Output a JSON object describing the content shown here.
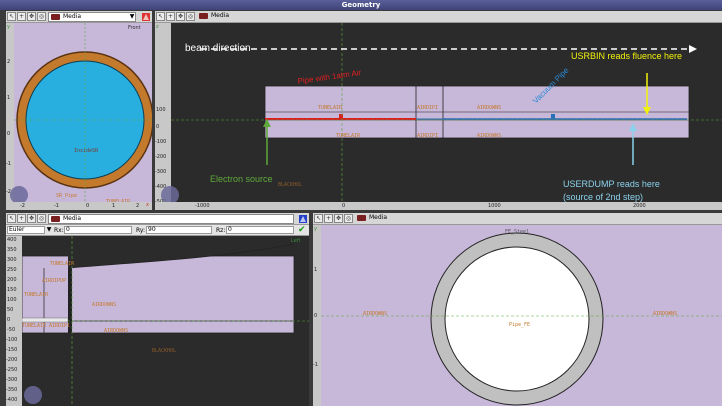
{
  "window": {
    "title": "Geometry"
  },
  "views": {
    "front": {
      "layer": "Media",
      "label": "Front",
      "regions": [
        "InsideSR",
        "SR_Pipe",
        "TUNELAIR"
      ],
      "ticks_y": [
        "2",
        "1",
        "0",
        "-1",
        "-2"
      ],
      "ticks_x": [
        "-2",
        "-1",
        "0",
        "1",
        "2"
      ],
      "axis": "y",
      "x_axis": "x"
    },
    "top": {
      "layer": "Media",
      "regions_top": [
        "TUNELAIR",
        "AIRDIPI",
        "AIRDOWNS"
      ],
      "regions_bottom": [
        "TUNELAIR",
        "AIRDIPI",
        "AIRDOWNS"
      ],
      "blackhole": "BLACKHOL",
      "ticks_y": [
        "100",
        "0",
        "-100",
        "-200",
        "-300",
        "-400",
        "-500"
      ],
      "ticks_x": [
        "-1000",
        "0",
        "1000",
        "2000"
      ],
      "axis": "z",
      "annotations": {
        "beam": "beam direction",
        "pipe": "Pipe with 1atm Air",
        "vacuum": "Vacuum Pipe",
        "usrbin": "USRBIN reads fluence here",
        "source": "Electron source",
        "userdump_1": "USERDUMP reads here",
        "userdump_2": "(source of 2nd  step)"
      }
    },
    "left": {
      "layer": "Media",
      "label": "Left",
      "rot_mode": "Euler",
      "rx_label": "Rx:",
      "rx": "0",
      "ry_label": "Ry:",
      "ry": "90",
      "rz_label": "Rz:",
      "rz": "0",
      "regions": [
        "TUNELAIR",
        "AIRDIPUP",
        "TUNELAIR",
        "AIRDOWNS",
        "TUNELAIR",
        "AIRDIPI",
        "AIRDOWNS",
        "BLACKHOL"
      ],
      "ticks_y": [
        "400",
        "350",
        "300",
        "250",
        "200",
        "150",
        "100",
        "50",
        "0",
        "-50",
        "-100",
        "-150",
        "-200",
        "-250",
        "-300",
        "-350",
        "-400"
      ]
    },
    "detail": {
      "layer": "Media",
      "regions": [
        "FE_Steel",
        "AIRDOWNS",
        "Pipe_FE",
        "AIRDOWNS"
      ],
      "ticks_y": [
        "1",
        "0",
        "-1"
      ],
      "axis": "y"
    }
  },
  "colors": {
    "region": "#c7b7d9",
    "steel": "#c0c0c0",
    "copper": "#c47a2c",
    "water": "#29aee0",
    "label": "#c47a2c",
    "bg": "#2b2b2b"
  }
}
